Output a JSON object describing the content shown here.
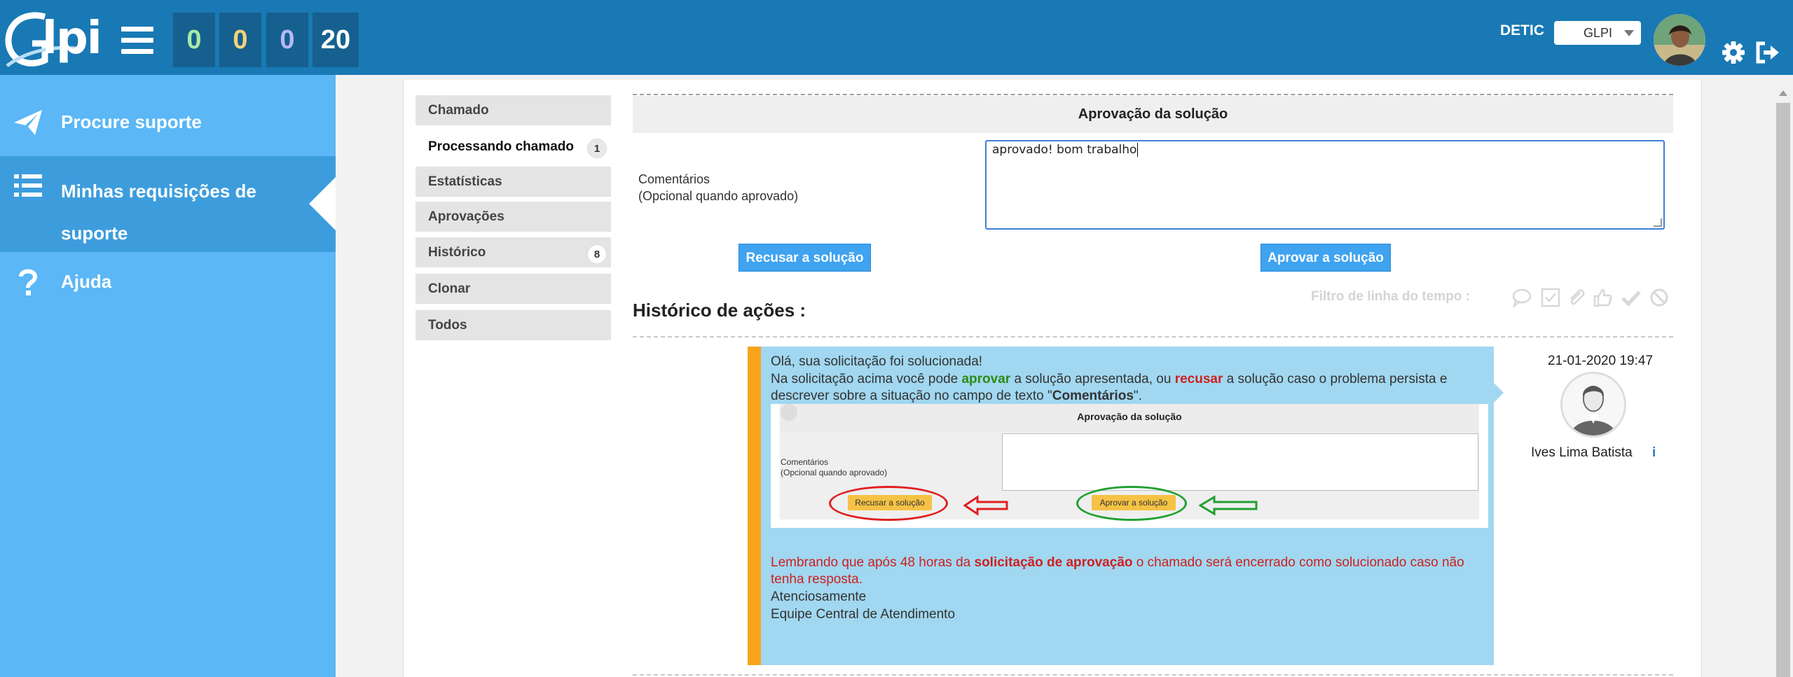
{
  "header": {
    "logo_text": "lpi",
    "counters": {
      "new": "0",
      "planned": "0",
      "waiting": "0",
      "total": "20"
    },
    "entity": "DETIC",
    "profile": "GLPI",
    "colors": {
      "bar": "#1979b4",
      "counter_bg": "#15608f"
    }
  },
  "sidebar": {
    "items": [
      {
        "label": "Procure suporte",
        "icon": "paper-plane-icon"
      },
      {
        "label": "Minhas requisições de suporte",
        "icon": "list-icon"
      },
      {
        "label": "Ajuda",
        "icon": "question-icon"
      }
    ]
  },
  "tabs": [
    {
      "label": "Chamado"
    },
    {
      "label": "Processando chamado",
      "badge": "1"
    },
    {
      "label": "Estatísticas"
    },
    {
      "label": "Aprovações"
    },
    {
      "label": "Histórico",
      "badge": "8"
    },
    {
      "label": "Clonar"
    },
    {
      "label": "Todos"
    }
  ],
  "approval": {
    "title": "Aprovação da solução",
    "comment_label_1": "Comentários",
    "comment_label_2": "(Opcional quando aprovado)",
    "comment_value": "aprovado! bom trabalho",
    "refuse_label": "Recusar a solução",
    "approve_label": "Aprovar a solução"
  },
  "history": {
    "title": "Histórico de ações :",
    "filter_label": "Filtro de linha do tempo :",
    "filter_icons": [
      "comment-icon",
      "task-icon",
      "paperclip-icon",
      "thumbs-up-icon",
      "check-icon",
      "ban-icon"
    ]
  },
  "solution": {
    "line1": "Olá, sua solicitação foi solucionada!",
    "line2_a": "Na solicitação acima você pode ",
    "line2_b": "aprovar",
    "line2_c": " a solução apresentada, ou ",
    "line2_d": "recusar",
    "line2_e": " a solução caso o problema persista e descrever sobre a situação no campo de texto \"",
    "line2_f": "Comentários",
    "line2_g": "\".",
    "embedded": {
      "title": "Aprovação da solução",
      "label_1": "Comentários",
      "label_2": "(Opcional quando aprovado)",
      "refuse": "Recusar a solução",
      "approve": "Aprovar a solução"
    },
    "line4_a": "Lembrando que após 48 horas da ",
    "line4_b": "solicitação de aprovação",
    "line4_c": " o chamado será encerrado como solucionado caso não tenha resposta.",
    "line5": "Atenciosamente",
    "line6": "Equipe Central de Atendimento",
    "date": "21-01-2020 19:47",
    "author": "Ives Lima Batista",
    "info_glyph": "i"
  }
}
